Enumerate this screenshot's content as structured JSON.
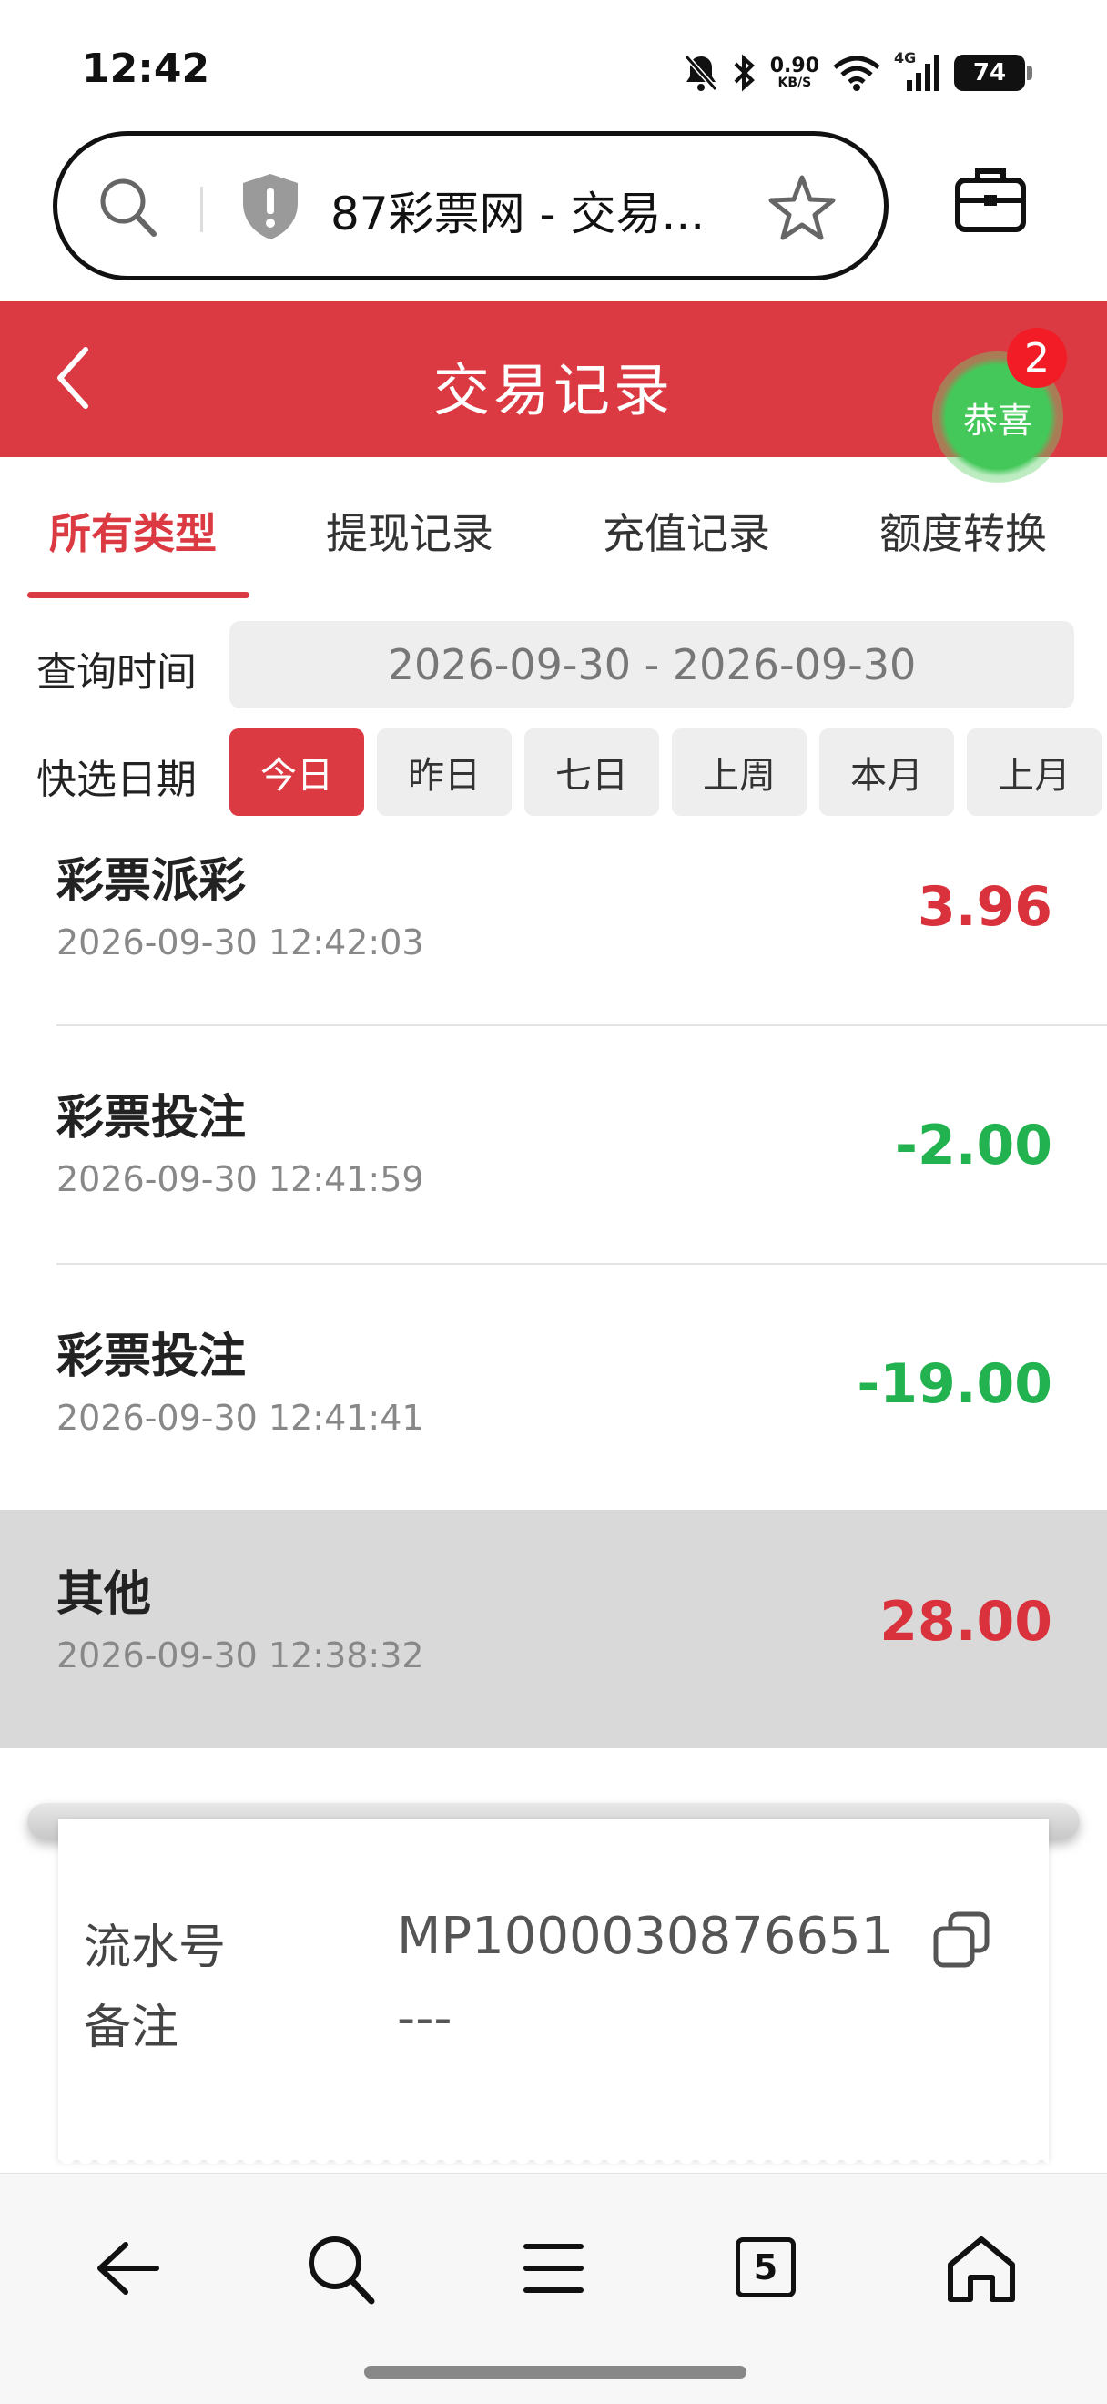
{
  "status_bar": {
    "time": "12:42",
    "net_speed": "0.90",
    "net_unit": "KB/S",
    "network_type": "4G",
    "battery": "74"
  },
  "browser": {
    "url_title": "87彩票网 - 交易...",
    "tab_count": "5"
  },
  "header": {
    "title": "交易记录",
    "float_button_label": "恭喜",
    "float_badge": "2",
    "accent": "#dc3a42"
  },
  "tabs": [
    {
      "label": "所有类型",
      "active": true
    },
    {
      "label": "提现记录",
      "active": false
    },
    {
      "label": "充值记录",
      "active": false
    },
    {
      "label": "额度转换",
      "active": false
    }
  ],
  "filters": {
    "query_label": "查询时间",
    "date_range": "2026-09-30 - 2026-09-30",
    "quick_label": "快选日期",
    "chips": [
      {
        "label": "今日",
        "active": true
      },
      {
        "label": "昨日",
        "active": false
      },
      {
        "label": "七日",
        "active": false
      },
      {
        "label": "上周",
        "active": false
      },
      {
        "label": "本月",
        "active": false
      },
      {
        "label": "上月",
        "active": false
      }
    ]
  },
  "records": [
    {
      "name": "彩票派彩",
      "time": "2026-09-30 12:42:03",
      "amount": "3.96",
      "sign": "positive"
    },
    {
      "name": "彩票投注",
      "time": "2026-09-30 12:41:59",
      "amount": "-2.00",
      "sign": "negative"
    },
    {
      "name": "彩票投注",
      "time": "2026-09-30 12:41:41",
      "amount": "-19.00",
      "sign": "negative"
    },
    {
      "name": "其他",
      "time": "2026-09-30 12:38:32",
      "amount": "28.00",
      "sign": "positive",
      "selected": true
    }
  ],
  "detail": {
    "serial_label": "流水号",
    "serial_value": "MP1000030876651",
    "note_label": "备注",
    "note_value": "---"
  },
  "colors": {
    "positive": "#d9323c",
    "negative": "#22b24f",
    "selected_row": "#d9d9d9"
  }
}
